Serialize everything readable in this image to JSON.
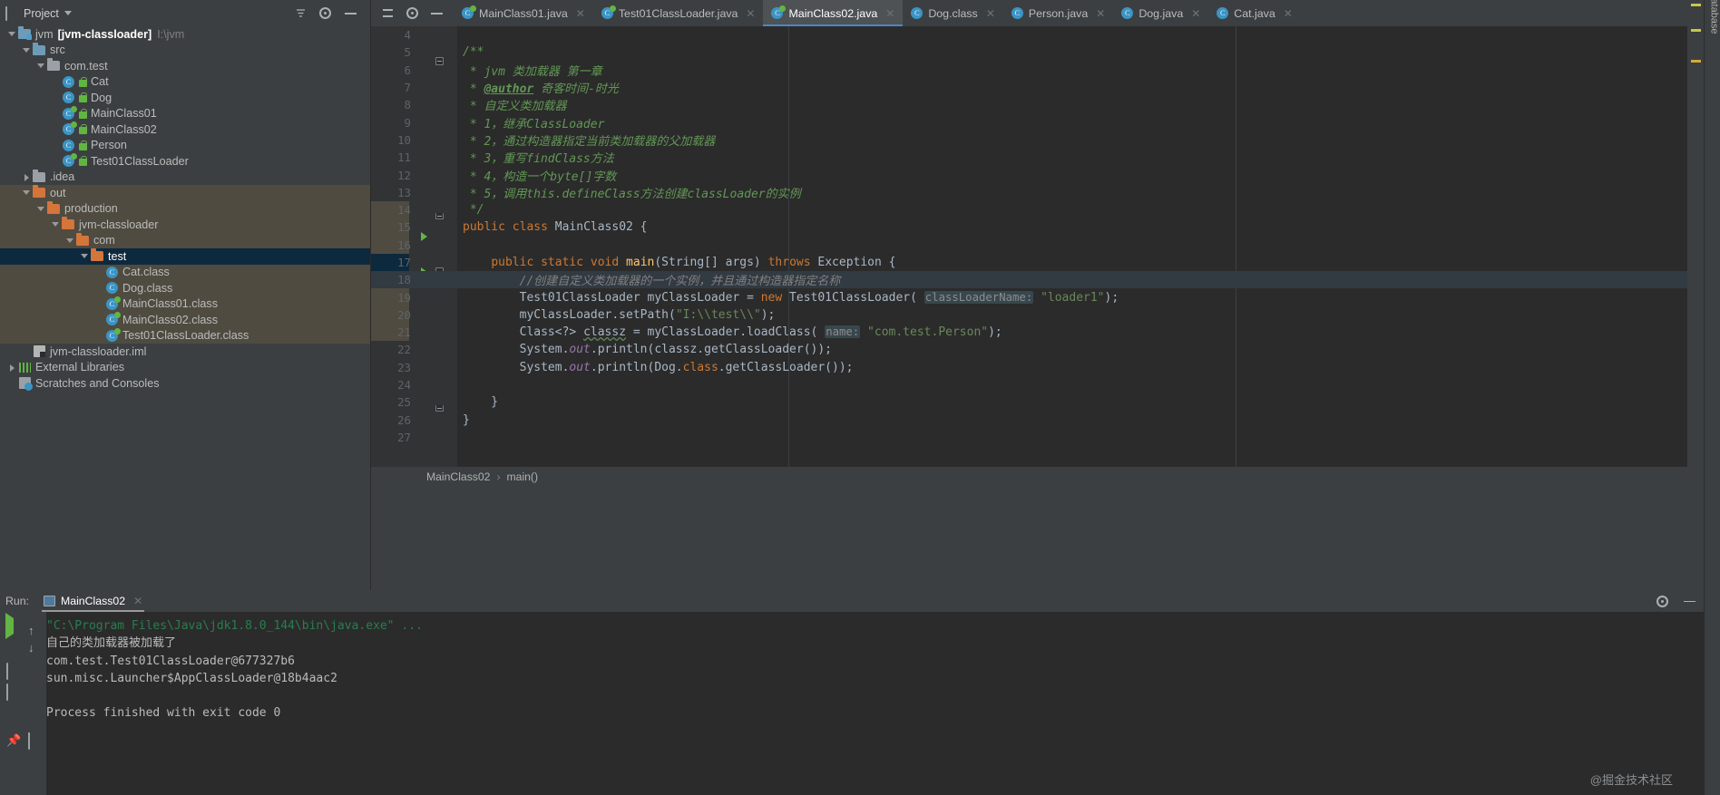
{
  "project_panel": {
    "header_title": "Project",
    "header_icons": [
      "project-icon",
      "chevron-down-icon",
      "sort-icon",
      "gear-icon",
      "minimize-icon"
    ],
    "tree": [
      {
        "depth": 0,
        "twist": "open",
        "icon": "module-folder",
        "label": "jvm",
        "bold": "[jvm-classloader]",
        "dim": "I:\\jvm",
        "scope": "none"
      },
      {
        "depth": 1,
        "twist": "open",
        "icon": "src-folder",
        "label": "src",
        "scope": "none"
      },
      {
        "depth": 2,
        "twist": "open",
        "icon": "package-folder",
        "label": "com.test",
        "scope": "none"
      },
      {
        "depth": 3,
        "twist": "none",
        "icon": "class-icon",
        "lock": true,
        "label": "Cat",
        "scope": "none"
      },
      {
        "depth": 3,
        "twist": "none",
        "icon": "class-icon",
        "lock": true,
        "label": "Dog",
        "scope": "none"
      },
      {
        "depth": 3,
        "twist": "none",
        "icon": "runnable-class-icon",
        "lock": true,
        "label": "MainClass01",
        "scope": "none"
      },
      {
        "depth": 3,
        "twist": "none",
        "icon": "runnable-class-icon",
        "lock": true,
        "label": "MainClass02",
        "scope": "none"
      },
      {
        "depth": 3,
        "twist": "none",
        "icon": "class-icon",
        "lock": true,
        "label": "Person",
        "scope": "none"
      },
      {
        "depth": 3,
        "twist": "none",
        "icon": "runnable-class-icon",
        "lock": true,
        "label": "Test01ClassLoader",
        "scope": "none"
      },
      {
        "depth": 1,
        "twist": "closed",
        "icon": "grey-folder",
        "label": ".idea",
        "scope": "none"
      },
      {
        "depth": 1,
        "twist": "open",
        "icon": "out-folder",
        "label": "out",
        "scope": "excluded"
      },
      {
        "depth": 2,
        "twist": "open",
        "icon": "out-folder",
        "label": "production",
        "scope": "excluded"
      },
      {
        "depth": 3,
        "twist": "open",
        "icon": "out-folder",
        "label": "jvm-classloader",
        "scope": "excluded"
      },
      {
        "depth": 4,
        "twist": "open",
        "icon": "out-folder",
        "label": "com",
        "scope": "excluded"
      },
      {
        "depth": 5,
        "twist": "open",
        "icon": "out-folder",
        "label": "test",
        "scope": "selected"
      },
      {
        "depth": 6,
        "twist": "none",
        "icon": "class-icon",
        "label": "Cat.class",
        "scope": "excluded"
      },
      {
        "depth": 6,
        "twist": "none",
        "icon": "class-icon",
        "label": "Dog.class",
        "scope": "excluded"
      },
      {
        "depth": 6,
        "twist": "none",
        "icon": "runnable-class-icon",
        "label": "MainClass01.class",
        "scope": "excluded"
      },
      {
        "depth": 6,
        "twist": "none",
        "icon": "runnable-class-icon",
        "label": "MainClass02.class",
        "scope": "excluded"
      },
      {
        "depth": 6,
        "twist": "none",
        "icon": "runnable-class-icon",
        "label": "Test01ClassLoader.class",
        "scope": "excluded"
      },
      {
        "depth": 1,
        "twist": "none",
        "icon": "iml-icon",
        "label": "jvm-classloader.iml",
        "scope": "none"
      },
      {
        "depth": 0,
        "twist": "closed",
        "icon": "external-libraries-icon",
        "label": "External Libraries",
        "scope": "none"
      },
      {
        "depth": 0,
        "twist": "none",
        "icon": "scratches-icon",
        "label": "Scratches and Consoles",
        "scope": "none"
      }
    ]
  },
  "editor": {
    "tabs": [
      {
        "label": "MainClass01.java",
        "icon": "runnable-class-icon",
        "active": false,
        "closable": true
      },
      {
        "label": "Test01ClassLoader.java",
        "icon": "runnable-class-icon",
        "active": false,
        "closable": true
      },
      {
        "label": "MainClass02.java",
        "icon": "runnable-class-icon",
        "active": true,
        "closable": true
      },
      {
        "label": "Dog.class",
        "icon": "class-icon",
        "active": false,
        "closable": true
      },
      {
        "label": "Person.java",
        "icon": "class-icon",
        "active": false,
        "closable": true
      },
      {
        "label": "Dog.java",
        "icon": "class-icon",
        "active": false,
        "closable": true
      },
      {
        "label": "Cat.java",
        "icon": "class-icon",
        "active": false,
        "closable": true
      }
    ],
    "breadcrumb": [
      "MainClass02",
      "main()"
    ],
    "breadcrumb_sep": "›",
    "first_visible_line": 4,
    "last_visible_line": 27,
    "code_lines": [
      {
        "n": 4,
        "text": ""
      },
      {
        "n": 5,
        "text": "/**",
        "fold": "start"
      },
      {
        "n": 6,
        "text": " * jvm 类加载器 第一章"
      },
      {
        "n": 7,
        "text": " * @author 奇客时间-时光"
      },
      {
        "n": 8,
        "text": " * 自定义类加载器"
      },
      {
        "n": 9,
        "text": " * 1，继承ClassLoader"
      },
      {
        "n": 10,
        "text": " * 2，通过构造器指定当前类加载器的父加载器"
      },
      {
        "n": 11,
        "text": " * 3，重写findClass方法"
      },
      {
        "n": 12,
        "text": " * 4，构造一个byte[]字数"
      },
      {
        "n": 13,
        "text": " * 5，调用this.defineClass方法创建classLoader的实例"
      },
      {
        "n": 14,
        "text": " */",
        "fold": "end"
      },
      {
        "n": 15,
        "text": "public class MainClass02 {",
        "run": true
      },
      {
        "n": 16,
        "text": ""
      },
      {
        "n": 17,
        "text": "    public static void main(String[] args) throws Exception {",
        "run": true,
        "fold": "start"
      },
      {
        "n": 18,
        "text": "        //创建自定义类加载器的一个实例，并且通过构造器指定名称",
        "highlight": true
      },
      {
        "n": 19,
        "text": "        Test01ClassLoader myClassLoader = new Test01ClassLoader( classLoaderName: \"loader1\");"
      },
      {
        "n": 20,
        "text": "        myClassLoader.setPath(\"I:\\\\test\\\\\");"
      },
      {
        "n": 21,
        "text": "        Class<?> classz = myClassLoader.loadClass( name: \"com.test.Person\");"
      },
      {
        "n": 22,
        "text": "        System.out.println(classz.getClassLoader());"
      },
      {
        "n": 23,
        "text": "        System.out.println(Dog.class.getClassLoader());"
      },
      {
        "n": 24,
        "text": ""
      },
      {
        "n": 25,
        "text": "    }",
        "fold": "end"
      },
      {
        "n": 26,
        "text": "}"
      },
      {
        "n": 27,
        "text": ""
      }
    ],
    "inlay_hints": [
      "classLoaderName:",
      "name:"
    ]
  },
  "run_panel": {
    "label": "Run:",
    "tab_name": "MainClass02",
    "toolbar_left": [
      "rerun-button",
      "stop-button",
      "pause-button",
      "restart-button",
      "thread-dump-button",
      "print-button",
      "delete-button",
      "pin-button"
    ],
    "toolbar_nav": [
      "up-arrow-button",
      "down-arrow-button"
    ],
    "header_right": [
      "gear-icon",
      "minimize-icon"
    ],
    "console_lines": [
      {
        "type": "cmd",
        "text": "\"C:\\Program Files\\Java\\jdk1.8.0_144\\bin\\java.exe\" ..."
      },
      {
        "type": "out",
        "text": "自己的类加载器被加载了"
      },
      {
        "type": "out",
        "text": "com.test.Test01ClassLoader@677327b6"
      },
      {
        "type": "out",
        "text": "sun.misc.Launcher$AppClassLoader@18b4aac2"
      },
      {
        "type": "out",
        "text": ""
      },
      {
        "type": "out",
        "text": "Process finished with exit code 0"
      }
    ]
  },
  "right_strip": {
    "database_label": "Database"
  },
  "watermark": "@掘金技术社区",
  "colors": {
    "accent": "#4a88c7",
    "selection": "#0d293e",
    "excluded_scope": "#4f4b41",
    "editor_bg": "#2b2b2b",
    "panel_bg": "#3c3f41",
    "keyword": "#cc7832",
    "string": "#6a8759",
    "comment": "#629755",
    "line_comment": "#808080",
    "field": "#9876aa",
    "method": "#ffc66d",
    "text": "#a9b7c6",
    "run_green": "#62b543"
  }
}
